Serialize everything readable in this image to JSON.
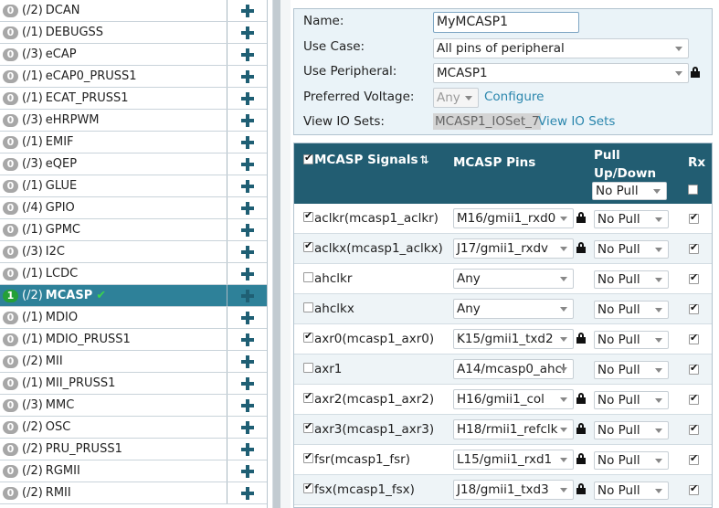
{
  "peripherals": [
    {
      "count": "0",
      "pins": "(/2)",
      "name": "DCAN"
    },
    {
      "count": "0",
      "pins": "(/1)",
      "name": "DEBUGSS"
    },
    {
      "count": "0",
      "pins": "(/3)",
      "name": "eCAP"
    },
    {
      "count": "0",
      "pins": "(/1)",
      "name": "eCAP0_PRUSS1"
    },
    {
      "count": "0",
      "pins": "(/1)",
      "name": "ECAT_PRUSS1"
    },
    {
      "count": "0",
      "pins": "(/3)",
      "name": "eHRPWM"
    },
    {
      "count": "0",
      "pins": "(/1)",
      "name": "EMIF"
    },
    {
      "count": "0",
      "pins": "(/3)",
      "name": "eQEP"
    },
    {
      "count": "0",
      "pins": "(/1)",
      "name": "GLUE"
    },
    {
      "count": "0",
      "pins": "(/4)",
      "name": "GPIO"
    },
    {
      "count": "0",
      "pins": "(/1)",
      "name": "GPMC"
    },
    {
      "count": "0",
      "pins": "(/3)",
      "name": "I2C"
    },
    {
      "count": "0",
      "pins": "(/1)",
      "name": "LCDC"
    },
    {
      "count": "1",
      "pins": "(/2)",
      "name": "MCASP",
      "active": true
    },
    {
      "count": "0",
      "pins": "(/1)",
      "name": "MDIO"
    },
    {
      "count": "0",
      "pins": "(/1)",
      "name": "MDIO_PRUSS1"
    },
    {
      "count": "0",
      "pins": "(/2)",
      "name": "MII"
    },
    {
      "count": "0",
      "pins": "(/1)",
      "name": "MII_PRUSS1"
    },
    {
      "count": "0",
      "pins": "(/3)",
      "name": "MMC"
    },
    {
      "count": "0",
      "pins": "(/2)",
      "name": "OSC"
    },
    {
      "count": "0",
      "pins": "(/2)",
      "name": "PRU_PRUSS1"
    },
    {
      "count": "0",
      "pins": "(/2)",
      "name": "RGMII"
    },
    {
      "count": "0",
      "pins": "(/2)",
      "name": "RMII"
    }
  ],
  "config": {
    "name_label": "Name:",
    "name_value": "MyMCASP1",
    "use_case_label": "Use Case:",
    "use_case_value": "All pins of peripheral",
    "use_peripheral_label": "Use Peripheral:",
    "use_peripheral_value": "MCASP1",
    "voltage_label": "Preferred Voltage:",
    "voltage_value": "Any",
    "configure_link": "Configure",
    "io_sets_label": "View IO Sets:",
    "io_sets_value": "MCASP1_IOSet_7",
    "io_sets_link": "View IO Sets"
  },
  "table": {
    "col_signals": "MCASP Signals",
    "col_pins": "MCASP Pins",
    "col_pull": "Pull Up/Down",
    "col_pull_line1": "Pull",
    "col_pull_line2": "Up/Down",
    "col_rx": "Rx",
    "header_pull_value": "No Pull",
    "rows": [
      {
        "checked": true,
        "signal": "aclkr(mcasp1_aclkr)",
        "pin": "M16/gmii1_rxd0",
        "locked": true,
        "pull": "No Pull",
        "rx": true
      },
      {
        "checked": true,
        "signal": "aclkx(mcasp1_aclkx)",
        "pin": "J17/gmii1_rxdv",
        "locked": true,
        "pull": "No Pull",
        "rx": true
      },
      {
        "checked": false,
        "signal": "ahclkr",
        "pin": "Any",
        "locked": false,
        "pull": "No Pull",
        "rx": true
      },
      {
        "checked": false,
        "signal": "ahclkx",
        "pin": "Any",
        "locked": false,
        "pull": "No Pull",
        "rx": true
      },
      {
        "checked": true,
        "signal": "axr0(mcasp1_axr0)",
        "pin": "K15/gmii1_txd2",
        "locked": true,
        "pull": "No Pull",
        "rx": true
      },
      {
        "checked": false,
        "signal": "axr1",
        "pin": "A14/mcasp0_ahcl",
        "locked": false,
        "pull": "No Pull",
        "rx": true
      },
      {
        "checked": true,
        "signal": "axr2(mcasp1_axr2)",
        "pin": "H16/gmii1_col",
        "locked": true,
        "pull": "No Pull",
        "rx": true
      },
      {
        "checked": true,
        "signal": "axr3(mcasp1_axr3)",
        "pin": "H18/rmii1_refclk",
        "locked": true,
        "pull": "No Pull",
        "rx": true
      },
      {
        "checked": true,
        "signal": "fsr(mcasp1_fsr)",
        "pin": "L15/gmii1_rxd1",
        "locked": true,
        "pull": "No Pull",
        "rx": true
      },
      {
        "checked": true,
        "signal": "fsx(mcasp1_fsx)",
        "pin": "J18/gmii1_txd3",
        "locked": true,
        "pull": "No Pull",
        "rx": true
      }
    ]
  },
  "icons": {
    "add": "plus-icon",
    "lock": "lock-icon",
    "ok": "checkmark-icon",
    "sort": "sort-icon"
  }
}
